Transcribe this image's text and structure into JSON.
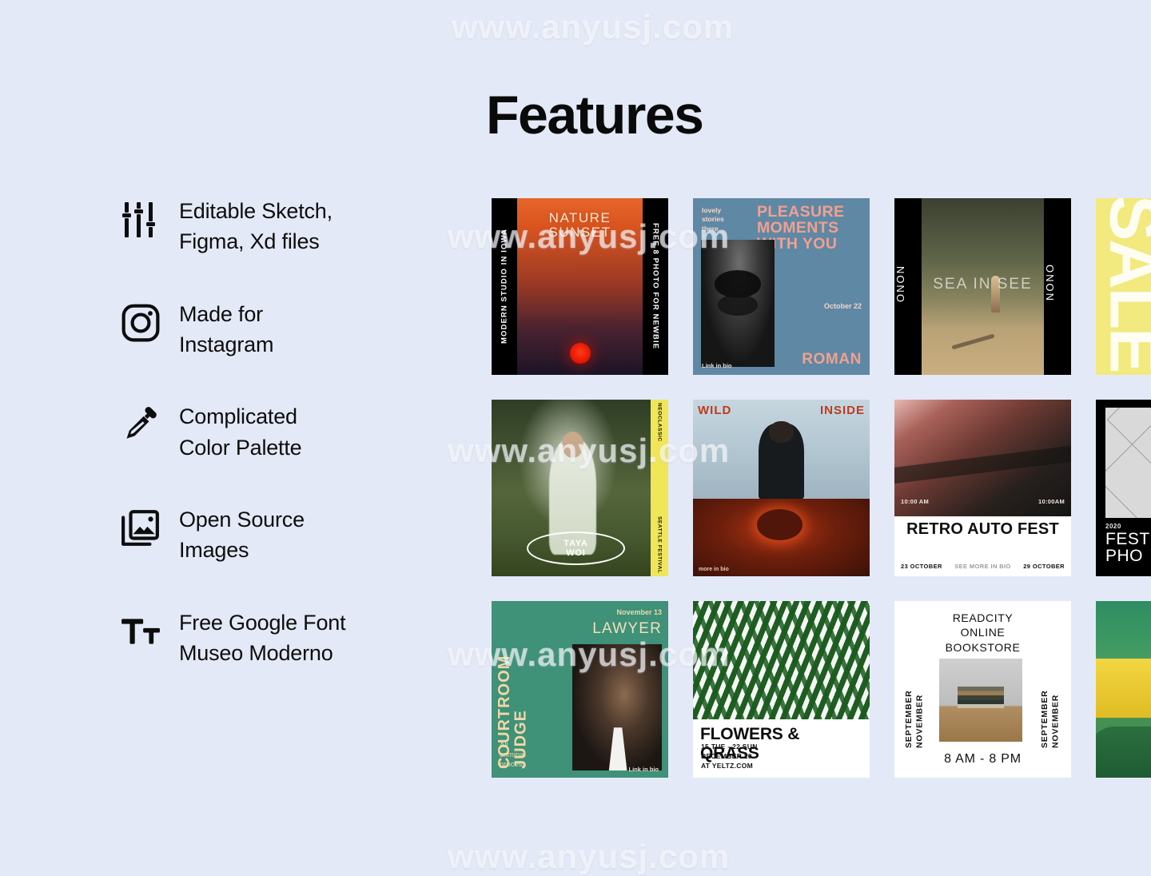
{
  "page": {
    "background": "#e4e9f7",
    "title": "Features",
    "watermark": "www.anyusj.com"
  },
  "features": [
    {
      "icon": "sliders-icon",
      "label": "Editable Sketch,\nFigma, Xd files"
    },
    {
      "icon": "instagram-icon",
      "label": "Made for\nInstagram"
    },
    {
      "icon": "eyedropper-icon",
      "label": "Complicated\nColor Palette"
    },
    {
      "icon": "images-icon",
      "label": "Open Source\nImages"
    },
    {
      "icon": "text-size-icon",
      "label": "Free Google Font\nMuseo Moderno"
    }
  ],
  "grid": {
    "columns": 4,
    "rows": 3,
    "cards": [
      {
        "id": "nature-sunset",
        "name": "nature-sunset-card",
        "left_strip": "MODERN STUDIO IN IOWA",
        "right_strip": "FREE 8 PHOTO FOR NEWBIE",
        "heading": "NATURE\nSUNSET",
        "colors": {
          "bar": "#000000",
          "sky_top": "#e6662a",
          "sky_bottom": "#1b1426",
          "sun": "#e31300"
        }
      },
      {
        "id": "pleasure-moments",
        "name": "pleasure-moments-card",
        "kicker": "lovely\nstories\nthere",
        "heading": "PLEASURE\nMOMENTS\nWITH YOU",
        "date": "October 22",
        "brand": "ROMAN",
        "link": "Link in bio",
        "colors": {
          "bg": "#5f88a4",
          "accent": "#f2a090"
        }
      },
      {
        "id": "sea-in-see",
        "name": "sea-in-see-card",
        "left_strip": "ONON",
        "right_strip": "ONON",
        "heading": "SEA IN SEE",
        "colors": {
          "bar": "#000000",
          "field": "#8a8560"
        }
      },
      {
        "id": "sale",
        "name": "sale-card",
        "heading": "SALE",
        "colors": {
          "bg": "#f2e97f",
          "text": "#fdfdf2"
        }
      },
      {
        "id": "taya-woi",
        "name": "taya-woi-card",
        "oval_line1": "TAYA",
        "oval_line2": "WOI",
        "strip_top": "NEOCLASSIC",
        "strip_bottom": "SEATTLE FESTIVAL",
        "colors": {
          "strip": "#f0e658"
        }
      },
      {
        "id": "wild-inside",
        "name": "wild-inside-card",
        "heading_left": "WILD",
        "heading_right": "INSIDE",
        "footer": "more in bio",
        "colors": {
          "top": "#b9cbd6",
          "bottom": "#6e1f0c",
          "text": "#c0391c"
        }
      },
      {
        "id": "retro-auto-fest",
        "name": "retro-auto-fest-card",
        "time_left": "10:00 AM",
        "time_right": "10:00AM",
        "title": "RETRO AUTO FEST",
        "date_left": "23 OCTOBER",
        "cta": "SEE MORE IN BIO",
        "date_right": "29 OCTOBER",
        "colors": {
          "bg": "#ffffff"
        }
      },
      {
        "id": "fest-photo",
        "name": "fest-photo-card",
        "year": "2020",
        "title": "FEST\nPHO",
        "colors": {
          "bg": "#000000",
          "square": "#d9d9d9"
        }
      },
      {
        "id": "courtroom-judge",
        "name": "courtroom-judge-card",
        "vertical_title": "COURTROOM\nJUDGE",
        "date": "November 13",
        "headline": "LAWYER",
        "note": "All\ncriminal\nprocess",
        "link": "Link in bio",
        "colors": {
          "bg": "#3f9178",
          "text": "#efd8a8"
        }
      },
      {
        "id": "flowers-grass",
        "name": "flowers-grass-card",
        "title": "FLOWERS & QRASS",
        "details": "15 TUE - 22 SUN\nDECEMBER 20\nAT YELTZ.COM",
        "colors": {
          "bg": "#ffffff",
          "leaf": "#1f5d22"
        }
      },
      {
        "id": "readcity-bookstore",
        "name": "readcity-bookstore-card",
        "heading": "READCITY\nONLINE\nBOOKSTORE",
        "side_left": "SEPTEMBER NOVEMBER",
        "side_right": "SEPTEMBER NOVEMBER",
        "hours": "8 AM - 8 PM",
        "colors": {
          "bg": "#ffffff"
        }
      },
      {
        "id": "city-green",
        "name": "city-green-card",
        "colors": {
          "bg": "#3f9a62",
          "truck": "#f2d642"
        }
      }
    ]
  }
}
